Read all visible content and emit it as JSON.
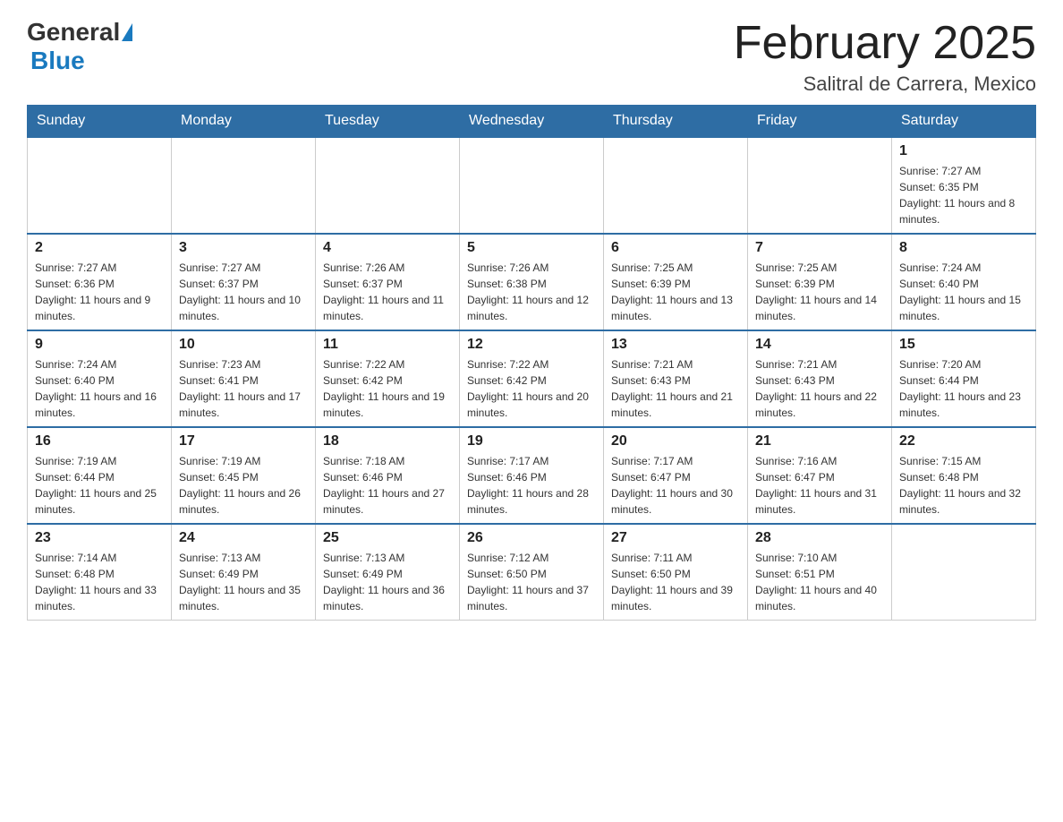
{
  "header": {
    "logo_general": "General",
    "logo_blue": "Blue",
    "title": "February 2025",
    "subtitle": "Salitral de Carrera, Mexico"
  },
  "weekdays": [
    "Sunday",
    "Monday",
    "Tuesday",
    "Wednesday",
    "Thursday",
    "Friday",
    "Saturday"
  ],
  "weeks": [
    [
      {
        "day": "",
        "info": ""
      },
      {
        "day": "",
        "info": ""
      },
      {
        "day": "",
        "info": ""
      },
      {
        "day": "",
        "info": ""
      },
      {
        "day": "",
        "info": ""
      },
      {
        "day": "",
        "info": ""
      },
      {
        "day": "1",
        "info": "Sunrise: 7:27 AM\nSunset: 6:35 PM\nDaylight: 11 hours and 8 minutes."
      }
    ],
    [
      {
        "day": "2",
        "info": "Sunrise: 7:27 AM\nSunset: 6:36 PM\nDaylight: 11 hours and 9 minutes."
      },
      {
        "day": "3",
        "info": "Sunrise: 7:27 AM\nSunset: 6:37 PM\nDaylight: 11 hours and 10 minutes."
      },
      {
        "day": "4",
        "info": "Sunrise: 7:26 AM\nSunset: 6:37 PM\nDaylight: 11 hours and 11 minutes."
      },
      {
        "day": "5",
        "info": "Sunrise: 7:26 AM\nSunset: 6:38 PM\nDaylight: 11 hours and 12 minutes."
      },
      {
        "day": "6",
        "info": "Sunrise: 7:25 AM\nSunset: 6:39 PM\nDaylight: 11 hours and 13 minutes."
      },
      {
        "day": "7",
        "info": "Sunrise: 7:25 AM\nSunset: 6:39 PM\nDaylight: 11 hours and 14 minutes."
      },
      {
        "day": "8",
        "info": "Sunrise: 7:24 AM\nSunset: 6:40 PM\nDaylight: 11 hours and 15 minutes."
      }
    ],
    [
      {
        "day": "9",
        "info": "Sunrise: 7:24 AM\nSunset: 6:40 PM\nDaylight: 11 hours and 16 minutes."
      },
      {
        "day": "10",
        "info": "Sunrise: 7:23 AM\nSunset: 6:41 PM\nDaylight: 11 hours and 17 minutes."
      },
      {
        "day": "11",
        "info": "Sunrise: 7:22 AM\nSunset: 6:42 PM\nDaylight: 11 hours and 19 minutes."
      },
      {
        "day": "12",
        "info": "Sunrise: 7:22 AM\nSunset: 6:42 PM\nDaylight: 11 hours and 20 minutes."
      },
      {
        "day": "13",
        "info": "Sunrise: 7:21 AM\nSunset: 6:43 PM\nDaylight: 11 hours and 21 minutes."
      },
      {
        "day": "14",
        "info": "Sunrise: 7:21 AM\nSunset: 6:43 PM\nDaylight: 11 hours and 22 minutes."
      },
      {
        "day": "15",
        "info": "Sunrise: 7:20 AM\nSunset: 6:44 PM\nDaylight: 11 hours and 23 minutes."
      }
    ],
    [
      {
        "day": "16",
        "info": "Sunrise: 7:19 AM\nSunset: 6:44 PM\nDaylight: 11 hours and 25 minutes."
      },
      {
        "day": "17",
        "info": "Sunrise: 7:19 AM\nSunset: 6:45 PM\nDaylight: 11 hours and 26 minutes."
      },
      {
        "day": "18",
        "info": "Sunrise: 7:18 AM\nSunset: 6:46 PM\nDaylight: 11 hours and 27 minutes."
      },
      {
        "day": "19",
        "info": "Sunrise: 7:17 AM\nSunset: 6:46 PM\nDaylight: 11 hours and 28 minutes."
      },
      {
        "day": "20",
        "info": "Sunrise: 7:17 AM\nSunset: 6:47 PM\nDaylight: 11 hours and 30 minutes."
      },
      {
        "day": "21",
        "info": "Sunrise: 7:16 AM\nSunset: 6:47 PM\nDaylight: 11 hours and 31 minutes."
      },
      {
        "day": "22",
        "info": "Sunrise: 7:15 AM\nSunset: 6:48 PM\nDaylight: 11 hours and 32 minutes."
      }
    ],
    [
      {
        "day": "23",
        "info": "Sunrise: 7:14 AM\nSunset: 6:48 PM\nDaylight: 11 hours and 33 minutes."
      },
      {
        "day": "24",
        "info": "Sunrise: 7:13 AM\nSunset: 6:49 PM\nDaylight: 11 hours and 35 minutes."
      },
      {
        "day": "25",
        "info": "Sunrise: 7:13 AM\nSunset: 6:49 PM\nDaylight: 11 hours and 36 minutes."
      },
      {
        "day": "26",
        "info": "Sunrise: 7:12 AM\nSunset: 6:50 PM\nDaylight: 11 hours and 37 minutes."
      },
      {
        "day": "27",
        "info": "Sunrise: 7:11 AM\nSunset: 6:50 PM\nDaylight: 11 hours and 39 minutes."
      },
      {
        "day": "28",
        "info": "Sunrise: 7:10 AM\nSunset: 6:51 PM\nDaylight: 11 hours and 40 minutes."
      },
      {
        "day": "",
        "info": ""
      }
    ]
  ]
}
